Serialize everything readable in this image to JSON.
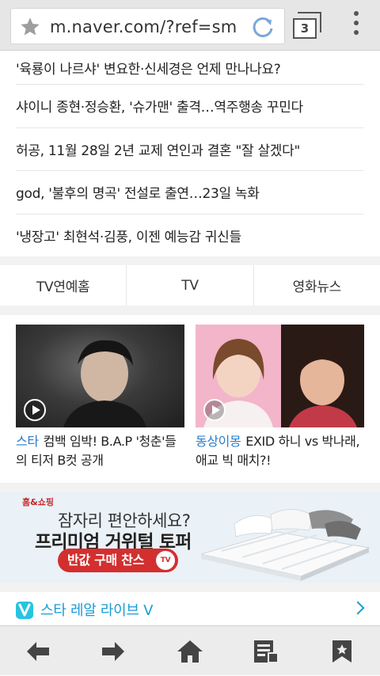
{
  "browser": {
    "url": "m.naver.com/?ref=sm",
    "tab_count": "3"
  },
  "headlines": [
    "'육룡이 나르샤' 변요한·신세경은 언제 만나나요?",
    "샤이니 종현·정승환, '슈가맨' 출격…역주행송 꾸민다",
    "허공, 11월 28일 2년 교제 연인과 결혼 \"잘 살겠다\"",
    "god, '불후의 명곡' 전설로 출연…23일 녹화",
    "'냉장고' 최현석·김풍, 이젠 예능감 귀신들"
  ],
  "category_tabs": [
    "TV연예홈",
    "TV",
    "영화뉴스"
  ],
  "cards": [
    {
      "tag": "스타",
      "caption": "컴백 임박! B.A.P '청춘'들의 티저 B컷 공개"
    },
    {
      "tag": "동상이몽",
      "caption": "EXID 하니 vs 박나래, 애교 빅 매치?!"
    }
  ],
  "ad": {
    "brand": "홈&쇼핑",
    "line1": "잠자리 편안하세요?",
    "line2": "프리미엄 거위털 토퍼",
    "cta": "반값 구매 찬스",
    "badge": "TV"
  },
  "vlive": {
    "label": "스타 레알 라이브 V"
  },
  "colors": {
    "accent": "#2a7cc7",
    "ad_red": "#d32f2f",
    "vlive": "#1a9bd6"
  }
}
